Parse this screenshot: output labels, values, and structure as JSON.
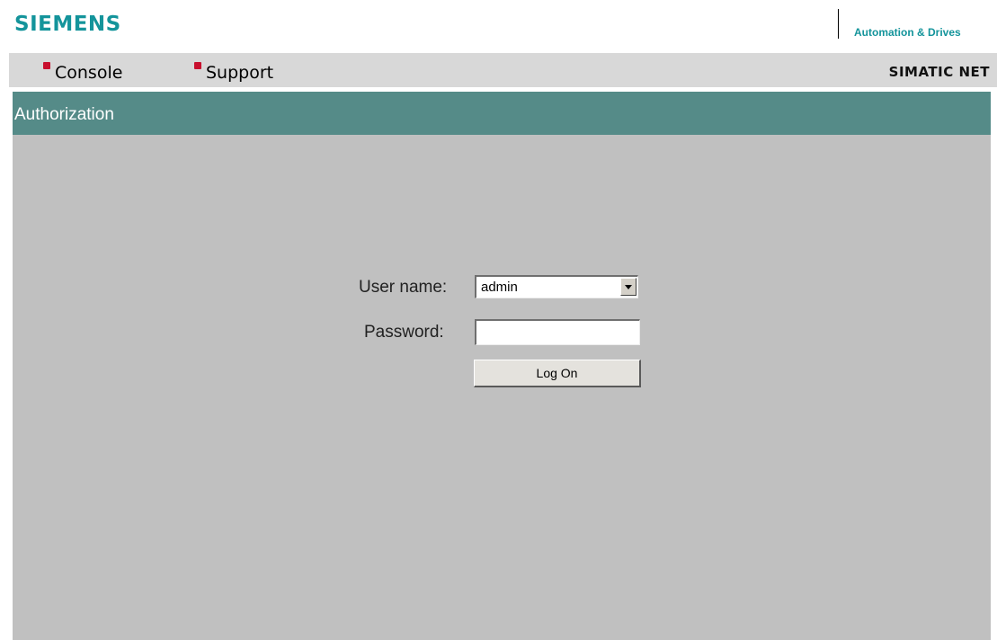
{
  "header": {
    "logo_text": "SIEMENS",
    "division": "Automation & Drives"
  },
  "nav": {
    "items": [
      {
        "label": "Console"
      },
      {
        "label": "Support"
      }
    ],
    "product": "SIMATIC NET"
  },
  "page": {
    "title": "Authorization"
  },
  "form": {
    "username_label": "User name:",
    "username_value": "admin",
    "password_label": "Password:",
    "password_value": "",
    "submit_label": "Log On"
  },
  "colors": {
    "brand": "#14949b",
    "title_bar": "#558b88",
    "nav_bullet": "#c8102e",
    "content_bg": "#c0c0c0"
  },
  "icons": {
    "nav_bullet": "red-square-bullet-icon",
    "dropdown": "chevron-down-icon"
  }
}
